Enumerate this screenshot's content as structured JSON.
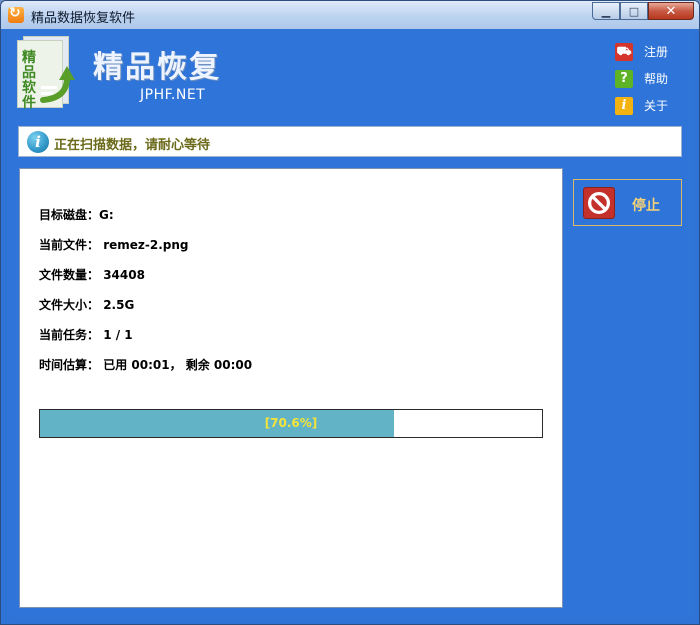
{
  "window": {
    "title": "精品数据恢复软件",
    "controls": {
      "minimize": "▁",
      "maximize": "□",
      "close": "✕"
    }
  },
  "header": {
    "logo_text": "精品软件",
    "brand_title": "精品恢复",
    "brand_subtitle": "JPHF.NET",
    "menu": [
      {
        "label": "注册",
        "icon": "cart-icon"
      },
      {
        "label": "帮助",
        "icon": "help-icon"
      },
      {
        "label": "关于",
        "icon": "info-icon"
      }
    ]
  },
  "status": {
    "icon": "info-icon",
    "message": "正在扫描数据，请耐心等待"
  },
  "scan": {
    "target_disk": {
      "label": "目标磁盘：",
      "value": "G:"
    },
    "current_file": {
      "label": "当前文件：",
      "value": "remez-2.png"
    },
    "file_count": {
      "label": "文件数量：",
      "value": "34408"
    },
    "file_size": {
      "label": "文件大小：",
      "value": "2.5G"
    },
    "current_task": {
      "label": "当前任务：",
      "value": "1 / 1"
    },
    "time_estimate": {
      "label": "时间估算：",
      "value": "已用 00:01， 剩余 00:00"
    }
  },
  "progress": {
    "percent": 70.6,
    "label": "[70.6%]"
  },
  "actions": {
    "stop_label": "停止"
  },
  "colors": {
    "client_background": "#2f74d8",
    "progress_fill": "#63b3c6",
    "progress_text": "#f4e43a",
    "stop_text": "#f3d27a"
  }
}
